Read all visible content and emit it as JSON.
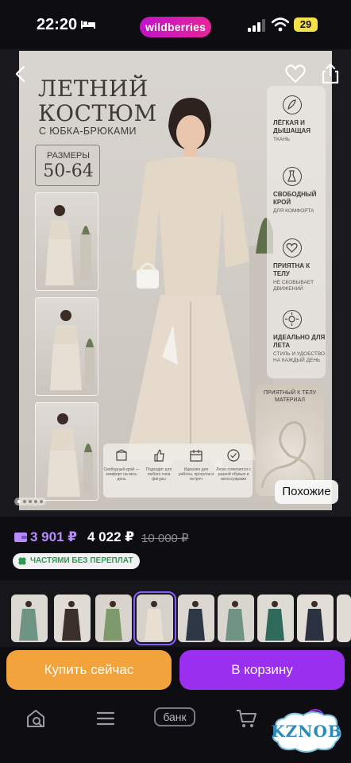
{
  "status_bar": {
    "time": "22:20",
    "brand": "wildberries",
    "battery": "29"
  },
  "poster": {
    "title_line1": "ЛЕТНИЙ",
    "title_line2": "КОСТЮМ",
    "subtitle": "С ЮБКА-БРЮКАМИ",
    "sizes_label": "РАЗМЕРЫ",
    "sizes_value": "50-64",
    "features": [
      {
        "icon": "feather-icon",
        "title": "ЛЁГКАЯ И ДЫШАЩАЯ",
        "sub": "ТКАНЬ"
      },
      {
        "icon": "dress-icon",
        "title": "СВОБОДНЫЙ КРОЙ",
        "sub": "ДЛЯ КОМФОРТА"
      },
      {
        "icon": "heart-icon",
        "title": "ПРИЯТНА К ТЕЛУ",
        "sub": "НЕ СКОВЫВАЕТ ДВИЖЕНИЙ"
      },
      {
        "icon": "sun-icon",
        "title": "ИДЕАЛЬНО ДЛЯ ЛЕТА",
        "sub": "СТИЛЬ И УДОБСТВО НА КАЖДЫЙ ДЕНЬ"
      }
    ],
    "fabric_label": "ПРИЯТНЫЙ К ТЕЛУ МАТЕРИАЛ",
    "bottom_badges": [
      {
        "icon": "box-icon",
        "text": "Свободный крой — комфорт на весь день"
      },
      {
        "icon": "thumbs-up-icon",
        "text": "Подходит для любого типа фигуры"
      },
      {
        "icon": "calendar-icon",
        "text": "Идеален для работы, прогулок и встреч"
      },
      {
        "icon": "check-circle-icon",
        "text": "Легко сочетается с разной обувью и аксессуарами"
      }
    ]
  },
  "similar_button": "Похожие",
  "prices": {
    "wallet": "3 901 ₽",
    "main": "4 022 ₽",
    "old": "10 000 ₽"
  },
  "installments": "ЧАСТЯМИ БЕЗ ПЕРЕПЛАТ",
  "buttons": {
    "buy_now": "Купить сейчас",
    "add_to_cart": "В корзину"
  },
  "tabbar": {
    "bank": "банк"
  },
  "watermark": "KZNOB",
  "colors": {
    "brand_gradient_start": "#c014c8",
    "brand_gradient_end": "#e8249a",
    "buy_now": "#f2a33c",
    "add_cart": "#9b2ff0",
    "wallet_price": "#b88cff",
    "installments_text": "#2e9a50"
  }
}
